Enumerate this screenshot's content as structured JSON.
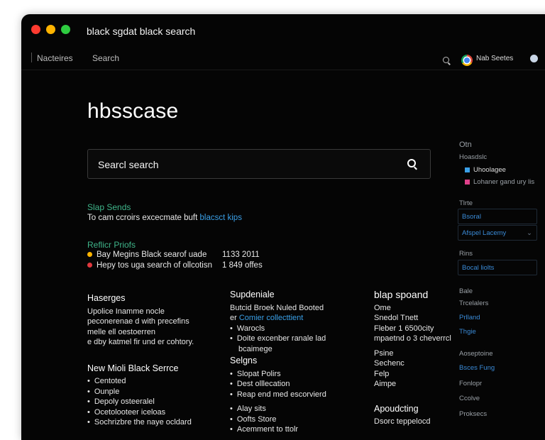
{
  "window": {
    "title": "black sgdat black search"
  },
  "navbar": {
    "items": [
      "Nacteires",
      "Search"
    ],
    "account": "Nab Seetes",
    "search_icon": "search-icon",
    "browser_icon": "chrome-icon"
  },
  "brand": "hbsscase",
  "search": {
    "placeholder": "Searcl search"
  },
  "colors": {
    "background": "#050505",
    "accent_green": "#3fb58a",
    "accent_blue": "#3aa0e8",
    "dot_yellow": "#ffb400",
    "dot_red": "#e0383e"
  },
  "intro": {
    "title": "Slap Sends",
    "text": "To cam ccroirs excecmate buft",
    "link": "blacsct kips"
  },
  "profiles": {
    "title": "Reflicr Priofs",
    "rows": [
      {
        "label": "Bay Megins Black searof uade",
        "value": "1133 2011"
      },
      {
        "label": "Hepy tos uga search of ollcotisn",
        "value": "1 849 offes"
      }
    ]
  },
  "col1": {
    "title": "Haserges",
    "lines": [
      "Upolice Inamme nocle",
      "peconerenae d with precefins",
      "melle ell oestoerren",
      "e dby katmel fir und er cohtory."
    ],
    "link_title": "New Mioli Black Serrce",
    "items": [
      "Centoted",
      "Ounple",
      "Depoly osteeralel",
      "Ocetolooteer iceloas",
      "Sochrizbre the naye ocldard"
    ]
  },
  "col2": {
    "title": "Supdeniale",
    "lines": [
      "Butcid Broek Nuled Booted"
    ],
    "link_line_prefix": "er",
    "link_line": "Comier collecttient",
    "items": [
      "Warocls",
      "Doite excenber ranale lad"
    ],
    "sub_line": "bcaimege",
    "green_title": "Selgns",
    "items2": [
      "Slopat Polirs",
      "Dest olllecation",
      "Reap end med escorvierd",
      "Alay sits",
      "Oofts Store",
      "Acemment to ttolr"
    ]
  },
  "col3": {
    "title": "blap spoand",
    "lines": [
      "Ome",
      "Snedol Tnett",
      "Fleber 1 6500city",
      "mpaetnd o 3 cheverrcl",
      "",
      "Psine",
      "Sechenc",
      "Felp",
      "Aimpe"
    ],
    "footer_title": "Apoudcting",
    "footer_line": "Dsorc teppelocd"
  },
  "sidebar": {
    "header": "Otn",
    "sub": "Hoasdslc",
    "legend": [
      {
        "label": "Uhoolagee",
        "color": "#3aa0e8"
      },
      {
        "label": "Lohaner gand ury lis",
        "color": "#e0408a"
      }
    ],
    "fields": [
      {
        "label": "Tlrte",
        "value": "Bsoral"
      },
      {
        "label": "",
        "value": "Afspel Lacemy"
      },
      {
        "label": "Rins",
        "value": "Bocal liolts"
      },
      {
        "label": "Bale",
        "value": ""
      },
      {
        "label": "Trcelalers",
        "value": "Prlland"
      },
      {
        "label": "",
        "value": "Thgie"
      }
    ],
    "bottom_items": [
      "Aoseptoine",
      "Bsces Fung",
      "Fonlopr",
      "Ccolve",
      "Proksecs"
    ]
  }
}
